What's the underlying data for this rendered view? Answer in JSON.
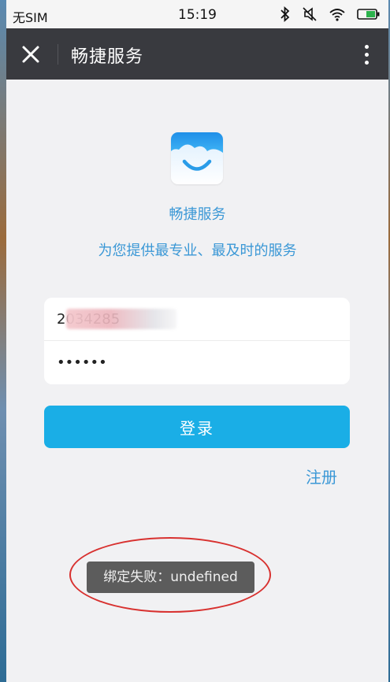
{
  "status_bar": {
    "carrier": "无SIM",
    "time": "15:19",
    "icons": [
      "bluetooth-icon",
      "mute-icon",
      "wifi-icon",
      "battery-icon"
    ]
  },
  "nav": {
    "title": "畅捷服务",
    "close_icon": "close-icon",
    "more_icon": "more-vertical-icon"
  },
  "app": {
    "name": "畅捷服务",
    "tagline": "为您提供最专业、最及时的服务",
    "logo_icon": "smile-cloud-logo"
  },
  "form": {
    "username_value": "2034285",
    "password_value": "123456"
  },
  "buttons": {
    "login_label": "登录",
    "register_label": "注册"
  },
  "toast": {
    "message": "绑定失败：undefined"
  },
  "colors": {
    "accent": "#1aaee6",
    "link": "#3b98d6",
    "navbar": "#393a3f",
    "annotation": "#d8312f"
  }
}
